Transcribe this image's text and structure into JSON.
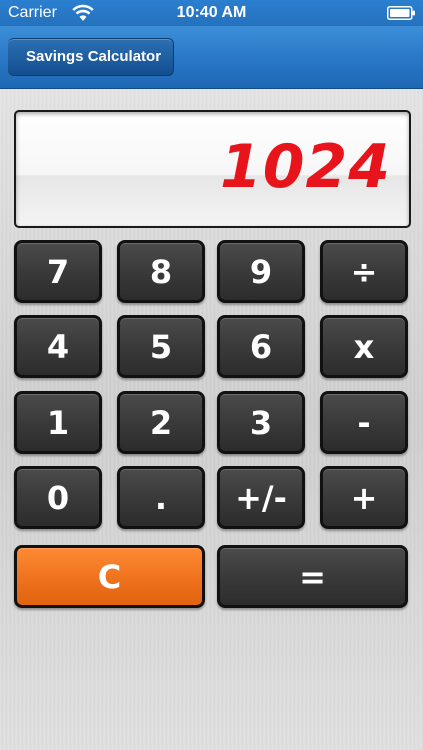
{
  "status_bar": {
    "carrier": "Carrier",
    "time": "10:40 AM",
    "icons": [
      "wifi-icon",
      "battery-icon"
    ]
  },
  "nav": {
    "back_label": "Savings Calculator"
  },
  "display": {
    "value": "1024",
    "color": "#e8141c"
  },
  "keys": {
    "k7": "7",
    "k8": "8",
    "k9": "9",
    "divide": "÷",
    "k4": "4",
    "k5": "5",
    "k6": "6",
    "multiply": "x",
    "k1": "1",
    "k2": "2",
    "k3": "3",
    "minus": "-",
    "k0": "0",
    "decimal": ".",
    "negate": "+/-",
    "plus": "+",
    "clear": "C",
    "equals": "="
  },
  "colors": {
    "accent_blue": "#2a79c8",
    "clear_key": "#f07420",
    "key_dark": "#3a3a3a"
  }
}
